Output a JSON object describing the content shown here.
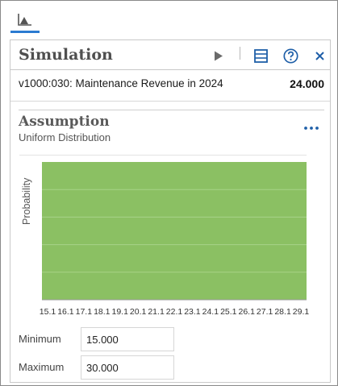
{
  "tabs": [
    {
      "icon": "chart-icon",
      "active": true
    }
  ],
  "panel": {
    "title": "Simulation",
    "icons": [
      "play-icon",
      "table-view-icon",
      "help-icon",
      "close-icon"
    ]
  },
  "simulation": {
    "name": "v1000:030: Maintenance Revenue in 2024",
    "value": "24.000"
  },
  "assumption": {
    "title": "Assumption",
    "distribution": "Uniform Distribution",
    "more_icon": "more-options-icon"
  },
  "chart_data": {
    "type": "area",
    "ylabel": "Probability",
    "xlabel": "",
    "x_ticks": [
      "15.1",
      "16.1",
      "17.1",
      "18.1",
      "19.1",
      "20.1",
      "21.1",
      "22.1",
      "23.1",
      "24.1",
      "25.1",
      "26.1",
      "27.1",
      "28.1",
      "29.1"
    ],
    "distribution": "uniform",
    "min": 15.0,
    "max": 30.0,
    "grid": true,
    "color": "#8bc063"
  },
  "fields": {
    "minimum_label": "Minimum",
    "minimum_value": "15.000",
    "maximum_label": "Maximum",
    "maximum_value": "30.000"
  },
  "colors": {
    "accent": "#2b7bd1",
    "fill": "#8bc063"
  }
}
